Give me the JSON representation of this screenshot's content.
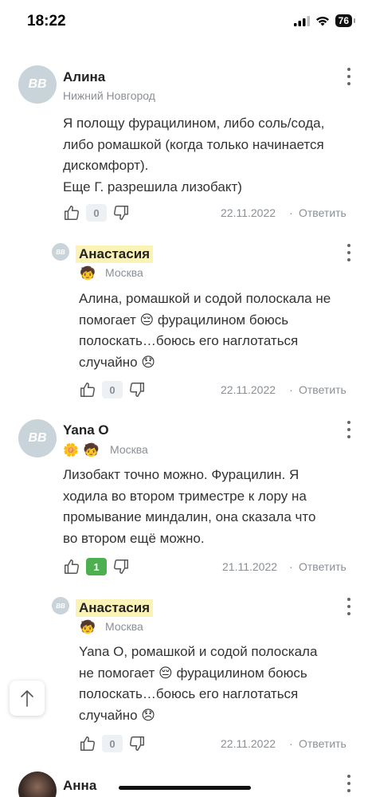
{
  "status_bar": {
    "time": "18:22",
    "battery": "76"
  },
  "comments": [
    {
      "avatar_text": "BB",
      "author": "Алина",
      "city": "Нижний Новгород",
      "text": [
        "Я полощу фурацилином, либо соль/сода,",
        "либо ромашкой (когда только начинается",
        "дискомфорт).",
        "Еще Г. разрешила лизобакт)"
      ],
      "votes": "0",
      "date": "22.11.2022",
      "reply_label": "Ответить"
    },
    {
      "avatar_text": "BB",
      "author": "Анастасия",
      "badges": [
        "🧒"
      ],
      "city": "Москва",
      "text": [
        "Алина, ромашкой и содой полоскала не",
        "помогает 😔 фурацилином боюсь",
        "полоскать…боюсь его наглотаться",
        "случайно 😞"
      ],
      "votes": "0",
      "date": "22.11.2022",
      "reply_label": "Ответить"
    },
    {
      "avatar_text": "BB",
      "author": "Yana O",
      "badges": [
        "🌼",
        "🧒"
      ],
      "city": "Москва",
      "text": [
        "Лизобакт точно можно. Фурацилин. Я",
        "ходила во втором триместре к лору на",
        "промывание миндалин, она сказала что",
        "во втором ещё можно."
      ],
      "votes": "1",
      "date": "21.11.2022",
      "reply_label": "Ответить"
    },
    {
      "avatar_text": "BB",
      "author": "Анастасия",
      "badges": [
        "🧒"
      ],
      "city": "Москва",
      "text": [
        "Yana O, ромашкой и содой полоскала",
        "не помогает 😔 фурацилином боюсь",
        "полоскать…боюсь его наглотаться",
        "случайно 😞"
      ],
      "votes": "0",
      "date": "22.11.2022",
      "reply_label": "Ответить"
    },
    {
      "author": "Анна"
    }
  ],
  "icons": {
    "like": "thumbs-up-icon",
    "dislike": "thumbs-down-icon",
    "menu": "more-vertical-icon",
    "scroll_top": "arrow-up-icon"
  },
  "colors": {
    "highlight": "#fbf3b6",
    "positive": "#4caf50",
    "muted": "#8a8f96"
  }
}
